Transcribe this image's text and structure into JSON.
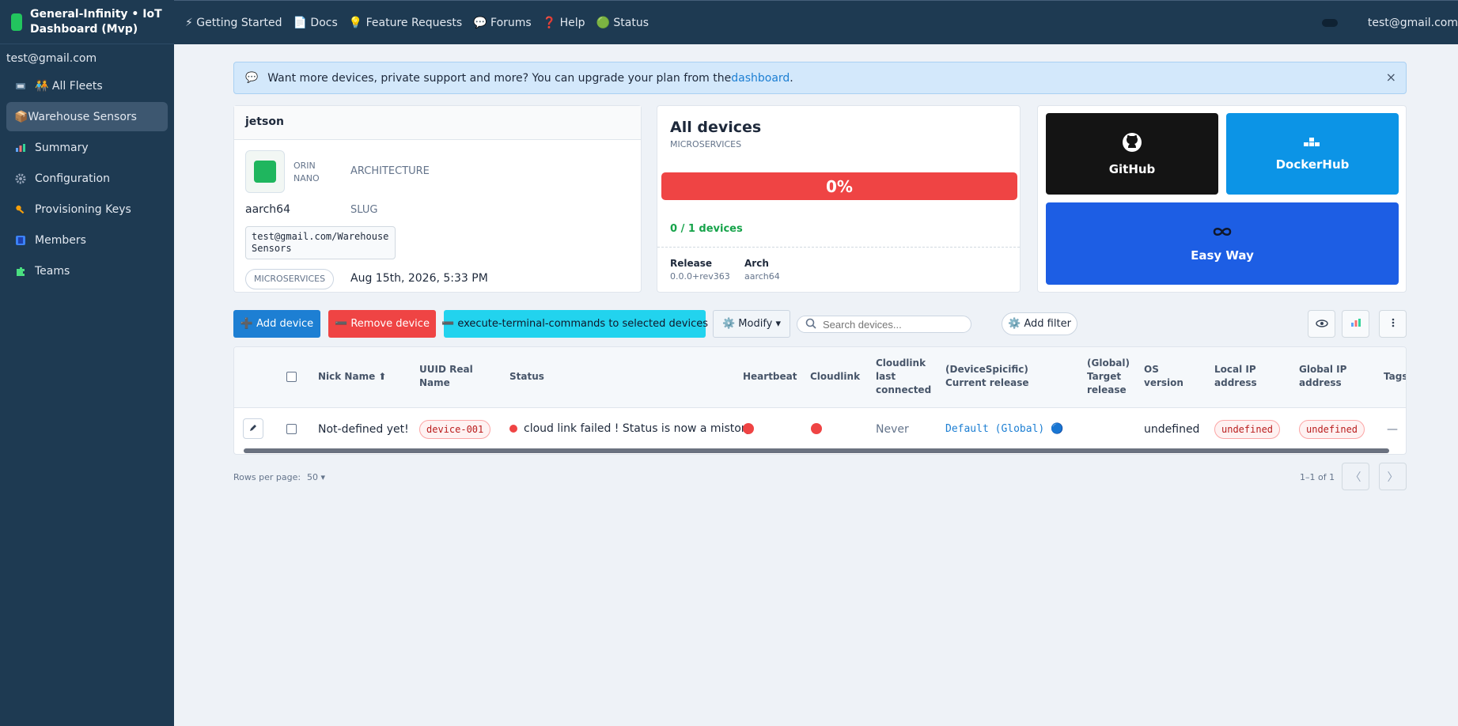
{
  "app": {
    "title": "General-Infinity • IoT Dashboard (Mvp)",
    "user_email": "test@gmail.com"
  },
  "topnav": [
    {
      "label": "⚡ Getting Started"
    },
    {
      "label": "📄 Docs"
    },
    {
      "label": "💡 Feature Requests"
    },
    {
      "label": "💬 Forums"
    },
    {
      "label": "❓ Help"
    },
    {
      "label": "🟢 Status"
    }
  ],
  "sidebar": {
    "user": "test@gmail.com",
    "items": [
      {
        "label": "🧑‍🤝‍🧑 All Fleets",
        "icon": "fleet-icon",
        "active": false
      },
      {
        "label": "📦Warehouse Sensors",
        "icon": "",
        "active": true
      },
      {
        "label": "Summary",
        "icon": "summary-icon",
        "active": false
      },
      {
        "label": "Configuration",
        "icon": "gear-icon",
        "active": false
      },
      {
        "label": "Provisioning Keys",
        "icon": "key-icon",
        "active": false
      },
      {
        "label": "Members",
        "icon": "members-icon",
        "active": false
      },
      {
        "label": "Teams",
        "icon": "teams-icon",
        "active": false
      }
    ]
  },
  "banner": {
    "icon": "💬",
    "text": "Want more devices, private support and more? You can upgrade your plan from the ",
    "link": "dashboard",
    "suffix": ".",
    "close": "×"
  },
  "device_card": {
    "title": "jetson",
    "model": "ORIN NANO",
    "architecture_label": "ARCHITECTURE",
    "arch_value": "aarch64",
    "slug_label": "SLUG",
    "slug_value": "test@gmail.com/Warehouse Sensors",
    "type_pill": "MICROSERVICES",
    "date": "Aug 15th, 2026, 5:33 PM"
  },
  "devices_card": {
    "title": "All devices",
    "subtitle": "MICROSERVICES",
    "progress_label": "0%",
    "progress_value": 0,
    "count": "0 / 1 devices",
    "release_label": "Release",
    "release_value": "0.0.0+rev363",
    "arch_label": "Arch",
    "arch_value": "aarch64"
  },
  "tiles": {
    "github": "GitHub",
    "dockerhub": "DockerHub",
    "easy": "Easy Way"
  },
  "toolbar": {
    "add": "➕ Add device",
    "remove": "➖ Remove device",
    "execute": "➖ execute-terminal-commands to selected devices",
    "modify": "⚙️ Modify ▾",
    "search_placeholder": "Search devices...",
    "filter": "⚙️ Add filter"
  },
  "table": {
    "headers": {
      "nick": "Nick Name ⬆",
      "uuid": "UUID Real Name",
      "status": "Status",
      "heartbeat": "Heartbeat",
      "cloudlink": "Cloudlink",
      "last": "Cloudlink last connected",
      "current": "(DeviceSpicific) Current release",
      "target": "(Global) Target release",
      "os": "OS version",
      "local_ip": "Local IP address",
      "global_ip": "Global IP address",
      "tags": "Tags"
    },
    "rows": [
      {
        "nick": "Not-defined yet!",
        "uuid": "device-001",
        "status": "cloud link failed ! Status is now a mistory",
        "last": "Never",
        "current": "Default (Global) 🔵",
        "os": "undefined",
        "local_ip": "undefined",
        "global_ip": "undefined",
        "tags": "—"
      }
    ]
  },
  "pager": {
    "rows_label": "Rows per page:",
    "rows_value": "50 ▾",
    "range": "1–1 of 1",
    "prev": "〈",
    "next": "〉"
  },
  "colors": {
    "sidebar": "#1e3a52",
    "primary": "#1d7fd3",
    "danger": "#ef4444",
    "cyan": "#22d3ee",
    "success": "#16a34a"
  }
}
